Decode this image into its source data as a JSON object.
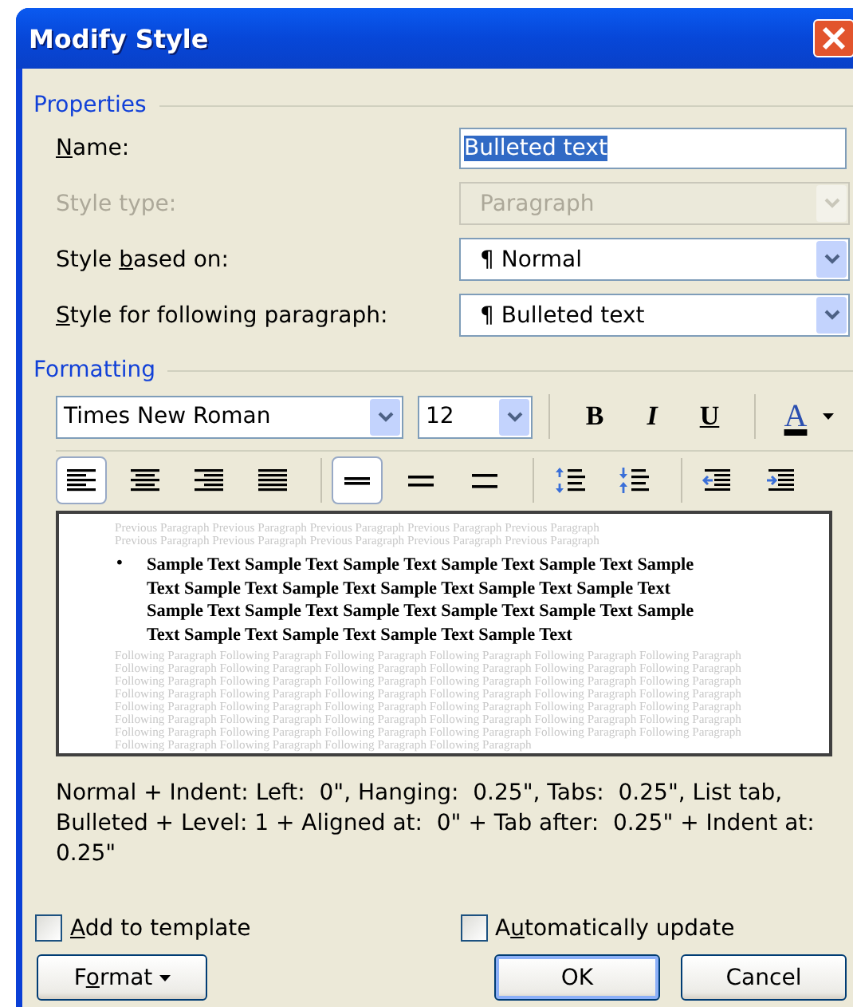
{
  "window": {
    "title": "Modify Style"
  },
  "properties": {
    "heading": "Properties",
    "fields": [
      {
        "kind": "text",
        "label": {
          "key": "N",
          "post": "ame:"
        },
        "value": "Bulleted text",
        "disabled": false,
        "highlighted": true
      },
      {
        "kind": "combo",
        "label": {
          "pre": "Style type:"
        },
        "value": "Paragraph",
        "disabled": true,
        "highlighted": false
      },
      {
        "kind": "combo",
        "label": {
          "pre": "Style ",
          "key": "b",
          "post": "ased on:"
        },
        "value": "¶ Normal",
        "disabled": false,
        "highlighted": false
      },
      {
        "kind": "combo",
        "label": {
          "key": "S",
          "post": "tyle for following paragraph:"
        },
        "value": "¶ Bulleted text",
        "disabled": false,
        "highlighted": false
      }
    ]
  },
  "formatting": {
    "heading": "Formatting",
    "font": "Times New Roman",
    "size": "12",
    "style_buttons": [
      {
        "kind": "bold",
        "label": "B"
      },
      {
        "kind": "italic",
        "label": "I"
      },
      {
        "kind": "underline",
        "label": "U"
      }
    ],
    "color_button": {
      "label": "A"
    },
    "alignment": [
      {
        "kind": "left",
        "selected": true
      },
      {
        "kind": "center",
        "selected": false
      },
      {
        "kind": "right",
        "selected": false
      },
      {
        "kind": "justify",
        "selected": false
      }
    ],
    "line_spacing": [
      {
        "kind": "single",
        "selected": true
      },
      {
        "kind": "one-half",
        "selected": false
      },
      {
        "kind": "double",
        "selected": false
      }
    ],
    "paragraph_spacing": [
      {
        "kind": "increase"
      },
      {
        "kind": "decrease"
      }
    ],
    "indent": [
      {
        "kind": "decrease"
      },
      {
        "kind": "increase"
      }
    ]
  },
  "preview": {
    "previous": [
      "Previous Paragraph Previous Paragraph Previous Paragraph Previous Paragraph Previous Paragraph",
      "Previous Paragraph Previous Paragraph Previous Paragraph Previous Paragraph Previous Paragraph"
    ],
    "bullet": "•",
    "sample": [
      "Sample Text Sample Text Sample Text Sample Text Sample Text Sample",
      "Text Sample Text Sample Text Sample Text Sample Text Sample Text",
      "Sample Text Sample Text Sample Text Sample Text Sample Text Sample",
      "Text Sample Text Sample Text Sample Text Sample Text"
    ],
    "following": [
      "Following Paragraph Following Paragraph Following Paragraph Following Paragraph Following Paragraph Following Paragraph",
      "Following Paragraph Following Paragraph Following Paragraph Following Paragraph Following Paragraph Following Paragraph",
      "Following Paragraph Following Paragraph Following Paragraph Following Paragraph Following Paragraph Following Paragraph",
      "Following Paragraph Following Paragraph Following Paragraph Following Paragraph Following Paragraph Following Paragraph",
      "Following Paragraph Following Paragraph Following Paragraph Following Paragraph Following Paragraph Following Paragraph",
      "Following Paragraph Following Paragraph Following Paragraph Following Paragraph Following Paragraph Following Paragraph",
      "Following Paragraph Following Paragraph Following Paragraph Following Paragraph Following Paragraph Following Paragraph",
      "Following Paragraph Following Paragraph Following Paragraph Following Paragraph"
    ]
  },
  "description": "Normal + Indent: Left:  0\", Hanging:  0.25\", Tabs:  0.25\", List tab, Bulleted + Level: 1 + Aligned at:  0\" + Tab after:  0.25\" + Indent at:  0.25\"",
  "options": [
    {
      "label": {
        "key": "A",
        "post": "dd to template"
      },
      "checked": false
    },
    {
      "label": {
        "pre": "A",
        "key": "u",
        "post": "tomatically update"
      },
      "checked": false
    }
  ],
  "buttons": [
    {
      "kind": "menu",
      "label": {
        "pre": "F",
        "key": "o",
        "post": "rmat"
      }
    },
    {
      "kind": "default",
      "label": {
        "pre": "OK"
      }
    },
    {
      "kind": "normal",
      "label": {
        "pre": "Cancel"
      }
    }
  ]
}
